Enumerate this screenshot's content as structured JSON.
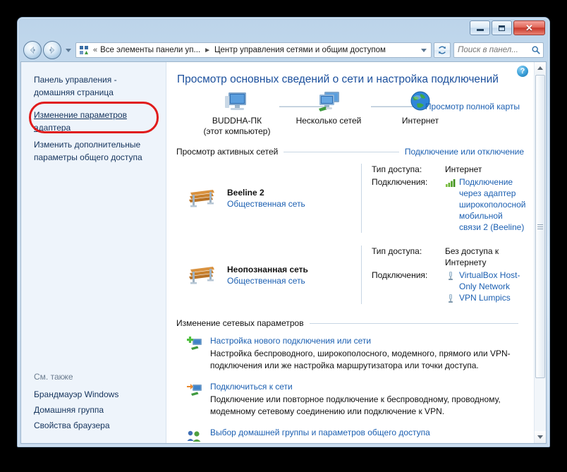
{
  "window": {
    "controls": {
      "minimize": "minimize-button",
      "maximize": "maximize-button",
      "close_label": "✕"
    }
  },
  "addressbar": {
    "back_tooltip": "Назад",
    "forward_tooltip": "Вперед",
    "overflow": "«",
    "crumb1": "Все элементы панели уп...",
    "separator": "►",
    "crumb2": "Центр управления сетями и общим доступом",
    "refresh": "refresh-icon",
    "search_placeholder": "Поиск в панел...",
    "search_value": ""
  },
  "sidebar": {
    "home_title": "Панель управления - домашняя страница",
    "links": [
      {
        "label": "Изменение параметров адаптера",
        "highlighted": true
      },
      {
        "label": "Изменить дополнительные параметры общего доступа",
        "highlighted": false
      }
    ],
    "see_also_title": "См. также",
    "see_also": [
      "Брандмауэр Windows",
      "Домашняя группа",
      "Свойства браузера"
    ],
    "annotation_color": "#e01b1b"
  },
  "content": {
    "help_label": "?",
    "page_title": "Просмотр основных сведений о сети и настройка подключений",
    "map": {
      "nodes": [
        {
          "label": "BUDDHA-ПК",
          "sublabel": "(этот компьютер)",
          "icon": "computer-icon"
        },
        {
          "label": "Несколько сетей",
          "sublabel": "",
          "icon": "multiple-networks-icon"
        },
        {
          "label": "Интернет",
          "sublabel": "",
          "icon": "globe-icon"
        }
      ],
      "full_map_link": "Просмотр полной карты"
    },
    "active_networks": {
      "header": "Просмотр активных сетей",
      "action": "Подключение или отключение",
      "rows": [
        {
          "name": "Beeline  2",
          "type": "Общественная сеть",
          "access_label": "Тип доступа:",
          "access_value": "Интернет",
          "connections_label": "Подключения:",
          "connections": [
            {
              "icon": "signal-bars-icon",
              "text": "Подключение через адаптер широкополосной мобильной связи 2 (Beeline)"
            }
          ]
        },
        {
          "name": "Неопознанная сеть",
          "type": "Общественная сеть",
          "access_label": "Тип доступа:",
          "access_value": "Без доступа к Интернету",
          "connections_label": "Подключения:",
          "connections": [
            {
              "icon": "network-plug-icon",
              "text": "VirtualBox Host-Only Network"
            },
            {
              "icon": "network-plug-icon",
              "text": "VPN Lumpics"
            }
          ]
        }
      ]
    },
    "settings": {
      "header": "Изменение сетевых параметров",
      "items": [
        {
          "icon": "new-connection-icon",
          "link": "Настройка нового подключения или сети",
          "desc": "Настройка беспроводного, широкополосного, модемного, прямого или VPN-подключения или же настройка маршрутизатора или точки доступа."
        },
        {
          "icon": "connect-network-icon",
          "link": "Подключиться к сети",
          "desc": "Подключение или повторное подключение к беспроводному, проводному, модемному сетевому соединению или подключение к VPN."
        },
        {
          "icon": "homegroup-icon",
          "link": "Выбор домашней группы и параметров общего доступа",
          "desc": ""
        }
      ]
    }
  }
}
